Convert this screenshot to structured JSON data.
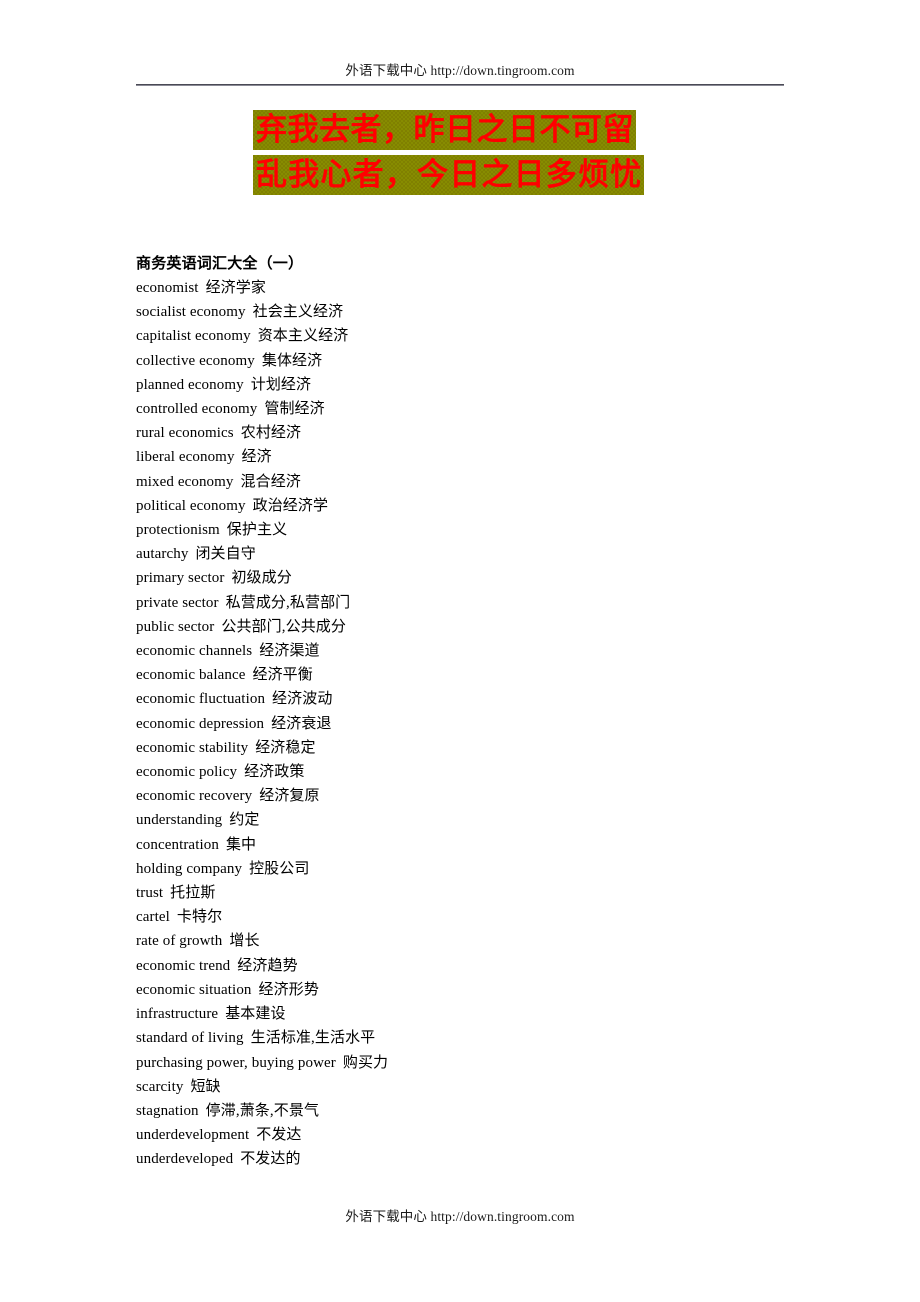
{
  "header": {
    "text": "外语下载中心 http://down.tingroom.com"
  },
  "banner": {
    "line1": "弃我去者，昨日之日不可留",
    "line2": "乱我心者，今日之日多烦忧",
    "text_color": "#ff0000",
    "background_color": "#808000"
  },
  "content": {
    "title": "商务英语词汇大全（一）",
    "entries": [
      {
        "term": "economist",
        "gloss": "经济学家"
      },
      {
        "term": "socialist economy",
        "gloss": "社会主义经济"
      },
      {
        "term": "capitalist economy",
        "gloss": "资本主义经济"
      },
      {
        "term": "collective economy",
        "gloss": "集体经济"
      },
      {
        "term": "planned economy",
        "gloss": "计划经济"
      },
      {
        "term": "controlled economy",
        "gloss": "管制经济"
      },
      {
        "term": "rural economics",
        "gloss": "农村经济"
      },
      {
        "term": "liberal economy",
        "gloss": "经济"
      },
      {
        "term": "mixed economy",
        "gloss": "混合经济"
      },
      {
        "term": "political economy",
        "gloss": "政治经济学"
      },
      {
        "term": "protectionism",
        "gloss": "保护主义"
      },
      {
        "term": "autarchy",
        "gloss": "闭关自守"
      },
      {
        "term": "primary sector",
        "gloss": "初级成分"
      },
      {
        "term": "private sector",
        "gloss": "私营成分,私营部门"
      },
      {
        "term": "public sector",
        "gloss": "公共部门,公共成分"
      },
      {
        "term": "economic channels",
        "gloss": "经济渠道"
      },
      {
        "term": "economic balance",
        "gloss": "经济平衡"
      },
      {
        "term": "economic fluctuation",
        "gloss": "经济波动"
      },
      {
        "term": "economic depression",
        "gloss": "经济衰退"
      },
      {
        "term": "economic stability",
        "gloss": "经济稳定"
      },
      {
        "term": "economic policy",
        "gloss": "经济政策"
      },
      {
        "term": "economic recovery",
        "gloss": "经济复原"
      },
      {
        "term": "understanding",
        "gloss": "约定"
      },
      {
        "term": "concentration",
        "gloss": "集中"
      },
      {
        "term": "holding company",
        "gloss": "控股公司"
      },
      {
        "term": "trust",
        "gloss": "托拉斯"
      },
      {
        "term": "cartel",
        "gloss": "卡特尔"
      },
      {
        "term": "rate of growth",
        "gloss": "增长"
      },
      {
        "term": "economic trend",
        "gloss": "经济趋势"
      },
      {
        "term": "economic situation",
        "gloss": "经济形势"
      },
      {
        "term": "infrastructure",
        "gloss": "基本建设"
      },
      {
        "term": "standard of living",
        "gloss": "生活标准,生活水平"
      },
      {
        "term": "purchasing power, buying power",
        "gloss": "购买力"
      },
      {
        "term": "scarcity",
        "gloss": "短缺"
      },
      {
        "term": "stagnation",
        "gloss": "停滞,萧条,不景气"
      },
      {
        "term": "underdevelopment",
        "gloss": "不发达"
      },
      {
        "term": "underdeveloped",
        "gloss": "不发达的"
      }
    ]
  },
  "footer": {
    "text": "外语下载中心 http://down.tingroom.com"
  }
}
